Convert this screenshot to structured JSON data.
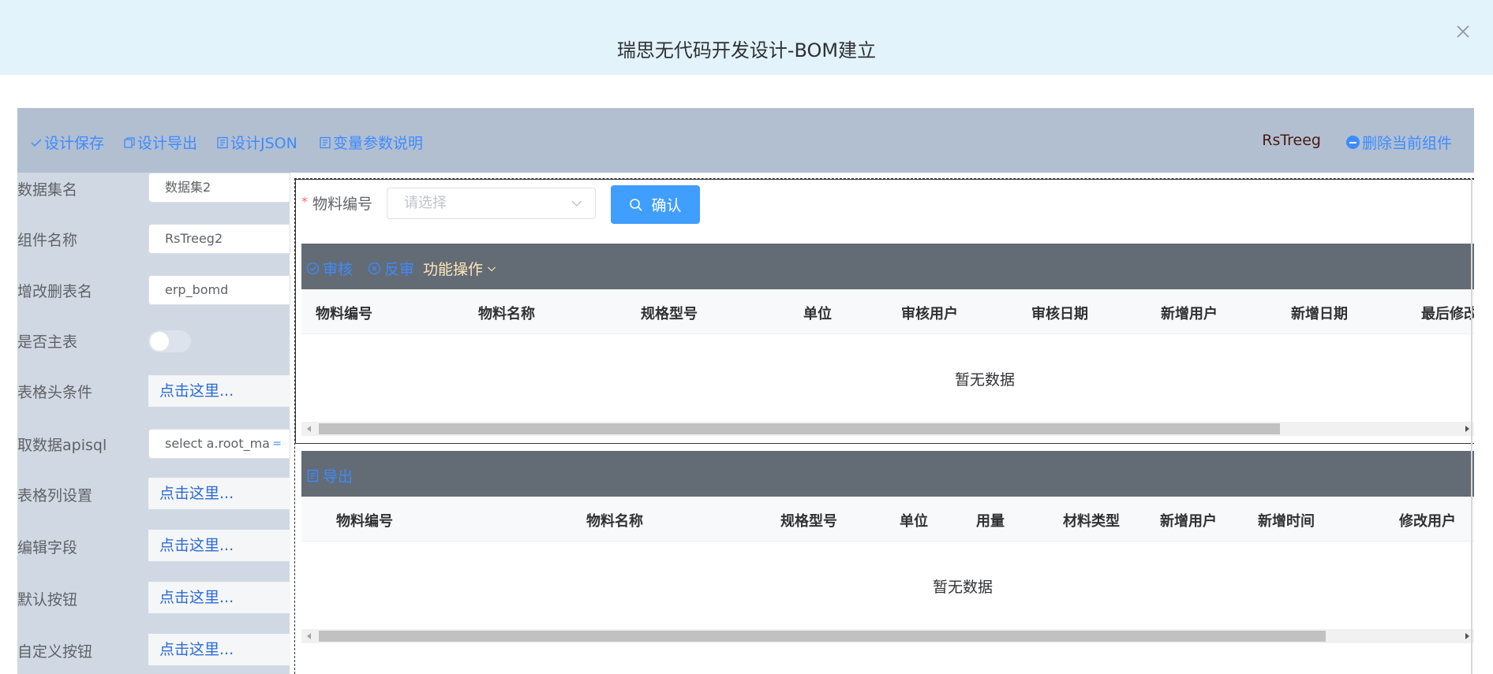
{
  "dialog": {
    "title": "瑞思无代码开发设计-BOM建立"
  },
  "toolbar": {
    "save": "设计保存",
    "export": "设计导出",
    "json": "设计JSON",
    "vars": "变量参数说明",
    "component": "RsTreeg",
    "delete": "删除当前组件"
  },
  "props": {
    "dataset_label": "数据集名",
    "dataset_value": "数据集2",
    "compname_label": "组件名称",
    "compname_value": "RsTreeg2",
    "crud_table_label": "增改删表名",
    "crud_table_value": "erp_bomd",
    "is_master_label": "是否主表",
    "is_master_value": false,
    "header_cond_label": "表格头条件",
    "header_cond_link": "点击这里...",
    "apisql_label": "取数据apisql",
    "apisql_value": "select a.root_ma",
    "columns_label": "表格列设置",
    "columns_link": "点击这里...",
    "edit_fields_label": "编辑字段",
    "edit_fields_link": "点击这里...",
    "default_btn_label": "默认按钮",
    "default_btn_link": "点击这里...",
    "custom_btn_label": "自定义按钮",
    "custom_btn_link": "点击这里..."
  },
  "form": {
    "label": "物料编号",
    "required_mark": "*",
    "placeholder": "请选择",
    "confirm": "确认"
  },
  "table1": {
    "ops": {
      "approve": "审核",
      "unapprove": "反审",
      "functions": "功能操作"
    },
    "columns": [
      "物料编号",
      "物料名称",
      "规格型号",
      "单位",
      "审核用户",
      "审核日期",
      "新增用户",
      "新增日期",
      "最后修改"
    ],
    "empty": "暂无数据"
  },
  "table2": {
    "ops": {
      "export": "导出"
    },
    "columns": [
      "物料编号",
      "物料名称",
      "规格型号",
      "单位",
      "用量",
      "材料类型",
      "新增用户",
      "新增时间",
      "修改用户"
    ],
    "empty": "暂无数据"
  },
  "colors": {
    "primary": "#409eff",
    "header_bg": "#e2f3fc",
    "toolbar_bg": "#b2bfd1",
    "panel_bg": "#d0d8e4",
    "ops_bar_bg": "#636b75",
    "ops_func_text": "#ffe7b8"
  }
}
